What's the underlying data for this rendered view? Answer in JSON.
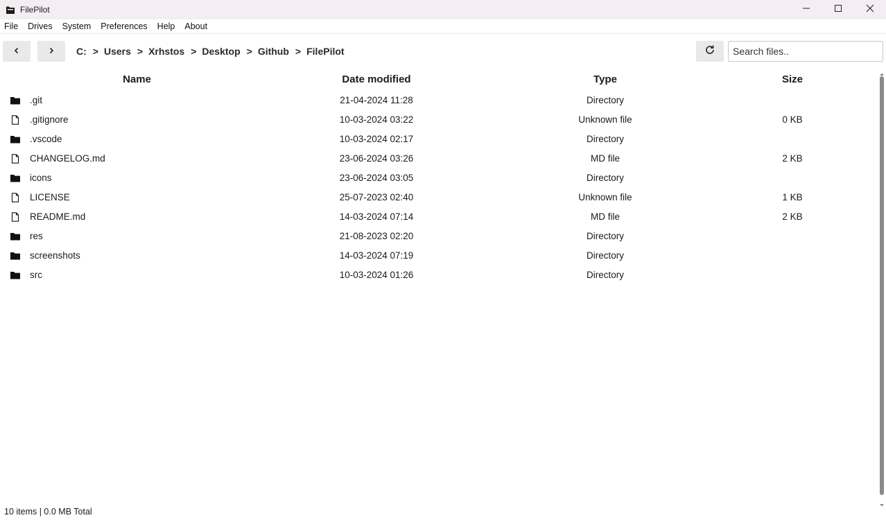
{
  "window": {
    "title": "FilePilot",
    "icon": "folder-app-icon",
    "controls": [
      "minimize-icon",
      "maximize-icon",
      "close-icon"
    ]
  },
  "menu": {
    "items": [
      "File",
      "Drives",
      "System",
      "Preferences",
      "Help",
      "About"
    ]
  },
  "toolbar": {
    "back_icon": "chevron-left-icon",
    "forward_icon": "chevron-right-icon",
    "refresh_icon": "refresh-icon",
    "breadcrumb": [
      "C:",
      "Users",
      "Xrhstos",
      "Desktop",
      "Github",
      "FilePilot"
    ],
    "breadcrumb_separator": ">",
    "search": {
      "placeholder": "Search files..",
      "value": ""
    }
  },
  "table": {
    "columns": [
      "Name",
      "Date modified",
      "Type",
      "Size"
    ],
    "rows": [
      {
        "icon": "folder-icon",
        "name": ".git",
        "date": "21-04-2024 11:28",
        "type": "Directory",
        "size": ""
      },
      {
        "icon": "file-icon",
        "name": ".gitignore",
        "date": "10-03-2024 03:22",
        "type": "Unknown file",
        "size": "0 KB"
      },
      {
        "icon": "folder-icon",
        "name": ".vscode",
        "date": "10-03-2024 02:17",
        "type": "Directory",
        "size": ""
      },
      {
        "icon": "file-icon",
        "name": "CHANGELOG.md",
        "date": "23-06-2024 03:26",
        "type": "MD file",
        "size": "2 KB"
      },
      {
        "icon": "folder-icon",
        "name": "icons",
        "date": "23-06-2024 03:05",
        "type": "Directory",
        "size": ""
      },
      {
        "icon": "file-icon",
        "name": "LICENSE",
        "date": "25-07-2023 02:40",
        "type": "Unknown file",
        "size": "1 KB"
      },
      {
        "icon": "file-icon",
        "name": "README.md",
        "date": "14-03-2024 07:14",
        "type": "MD file",
        "size": "2 KB"
      },
      {
        "icon": "folder-icon",
        "name": "res",
        "date": "21-08-2023 02:20",
        "type": "Directory",
        "size": ""
      },
      {
        "icon": "folder-icon",
        "name": "screenshots",
        "date": "14-03-2024 07:19",
        "type": "Directory",
        "size": ""
      },
      {
        "icon": "folder-icon",
        "name": "src",
        "date": "10-03-2024 01:26",
        "type": "Directory",
        "size": ""
      }
    ]
  },
  "status": {
    "text": "10 items | 0.0 MB Total"
  },
  "colors": {
    "titlebar_bg": "#f4eef3",
    "button_bg": "#e9e9e9",
    "scroll_thumb": "#8a8a8a"
  }
}
